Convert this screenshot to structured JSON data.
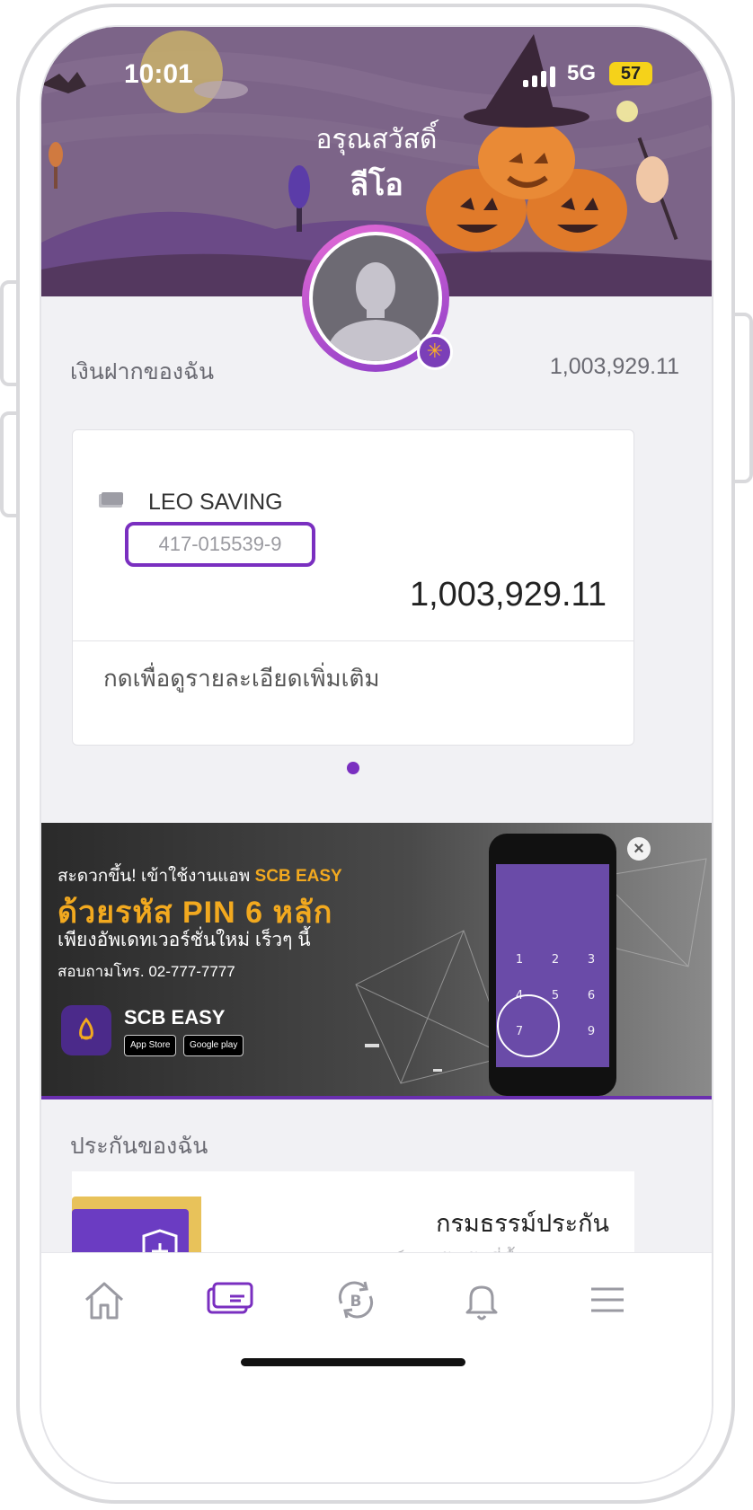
{
  "status_bar": {
    "time": "10:01",
    "network": "5G",
    "battery": "57"
  },
  "header": {
    "greeting": "อรุณสวัสดิ์",
    "name": "ลีโอ"
  },
  "deposits": {
    "label": "เงินฝากของฉัน",
    "total": "1,003,929.11",
    "account": {
      "name": "LEO SAVING",
      "number": "417-015539-9",
      "balance": "1,003,929.11",
      "more_link": "กดเพื่อดูรายละเอียดเพิ่มเติม"
    }
  },
  "banner": {
    "line1_prefix": "สะดวกขึ้น! เข้าใช้งานแอพ",
    "line1_brand": "SCB EASY",
    "line2": "ด้วยรหัส PIN 6 หลัก",
    "line3": "เพียงอัพเดทเวอร์ชั่นใหม่ เร็วๆ นี้",
    "line4": "สอบถามโทร. 02-777-7777",
    "app_name": "SCB EASY",
    "app_store": "App Store",
    "google_play": "Google play"
  },
  "insurance": {
    "label": "ประกันของฉัน",
    "title": "กรมธรรม์ประกัน",
    "subtitle": "กรมธรรม์ประกันภัยที่ซื้อผ่าน SCB"
  },
  "tabs": [
    {
      "icon": "home-icon"
    },
    {
      "icon": "card-icon"
    },
    {
      "icon": "transfer-baht-icon"
    },
    {
      "icon": "bell-icon"
    },
    {
      "icon": "menu-icon"
    }
  ],
  "colors": {
    "brand": "#7a2fc0",
    "accent": "#f2a91f",
    "header_bg": "#7a6287"
  }
}
